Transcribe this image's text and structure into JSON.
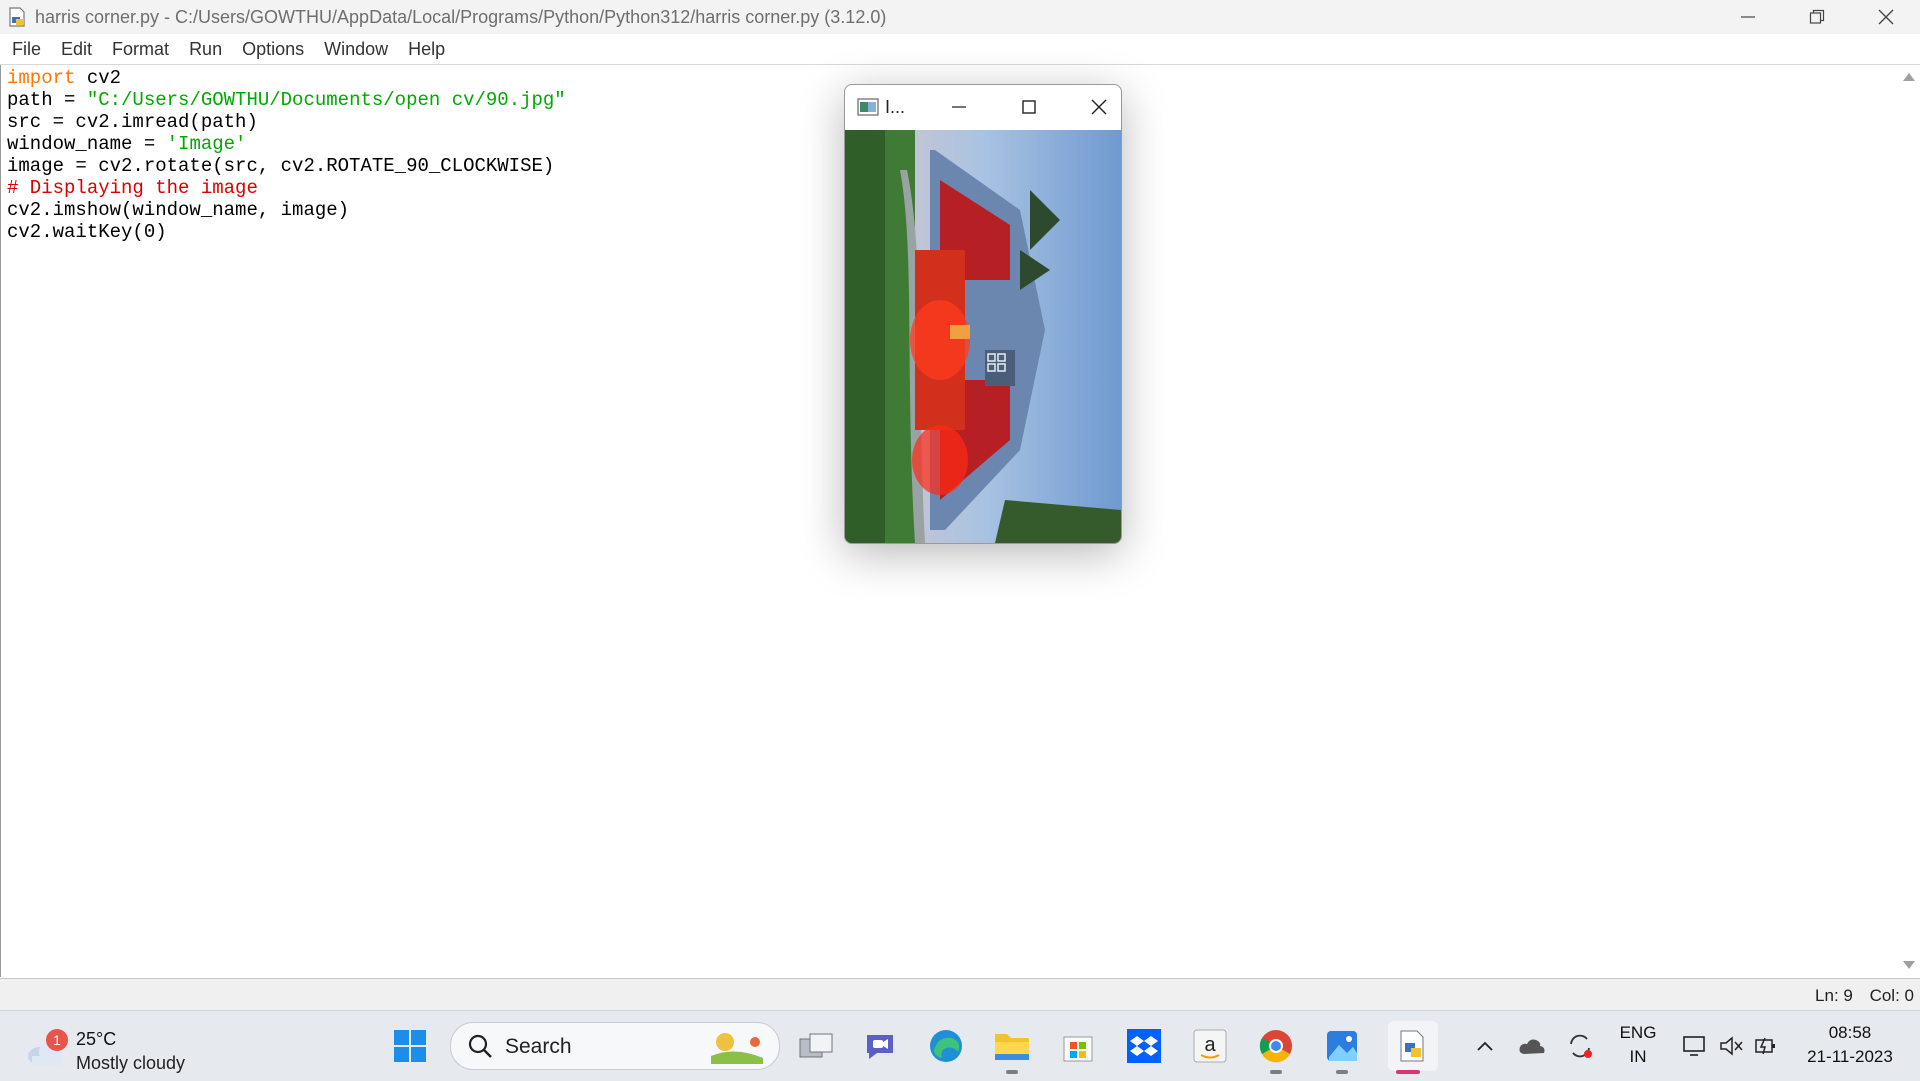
{
  "window": {
    "title": "harris corner.py - C:/Users/GOWTHU/AppData/Local/Programs/Python/Python312/harris corner.py (3.12.0)"
  },
  "menu": [
    "File",
    "Edit",
    "Format",
    "Run",
    "Options",
    "Window",
    "Help"
  ],
  "code_lines": [
    [
      {
        "t": "import",
        "c": "kw"
      },
      {
        "t": " cv2",
        "c": ""
      }
    ],
    [
      {
        "t": "path = ",
        "c": ""
      },
      {
        "t": "\"C:/Users/GOWTHU/Documents/open cv/90.jpg\"",
        "c": "str"
      }
    ],
    [
      {
        "t": "src = cv2.imread(path)",
        "c": ""
      }
    ],
    [
      {
        "t": "window_name = ",
        "c": ""
      },
      {
        "t": "'Image'",
        "c": "str"
      }
    ],
    [
      {
        "t": "image = cv2.rotate(src, cv2.ROTATE_90_CLOCKWISE)",
        "c": ""
      }
    ],
    [
      {
        "t": "# Displaying the image",
        "c": "cmt"
      }
    ],
    [
      {
        "t": "cv2.imshow(window_name, image)",
        "c": ""
      }
    ],
    [
      {
        "t": "cv2.waitKey(0)",
        "c": ""
      }
    ]
  ],
  "status": {
    "line": "Ln: 9",
    "col": "Col: 0"
  },
  "image_window": {
    "title": "I..."
  },
  "taskbar": {
    "weather": {
      "temp": "25°C",
      "condition": "Mostly cloudy",
      "badge": "1"
    },
    "search_label": "Search",
    "language": {
      "line1": "ENG",
      "line2": "IN"
    },
    "time": "08:58",
    "date": "21-11-2023",
    "apps": [
      "windows-start",
      "search",
      "task-view",
      "teams",
      "edge",
      "file-explorer",
      "microsoft-store",
      "dropbox",
      "amazon",
      "chrome",
      "photos",
      "idle"
    ]
  },
  "colors": {
    "keyword": "#ff7700",
    "string": "#00aa00",
    "comment": "#dd0000"
  }
}
